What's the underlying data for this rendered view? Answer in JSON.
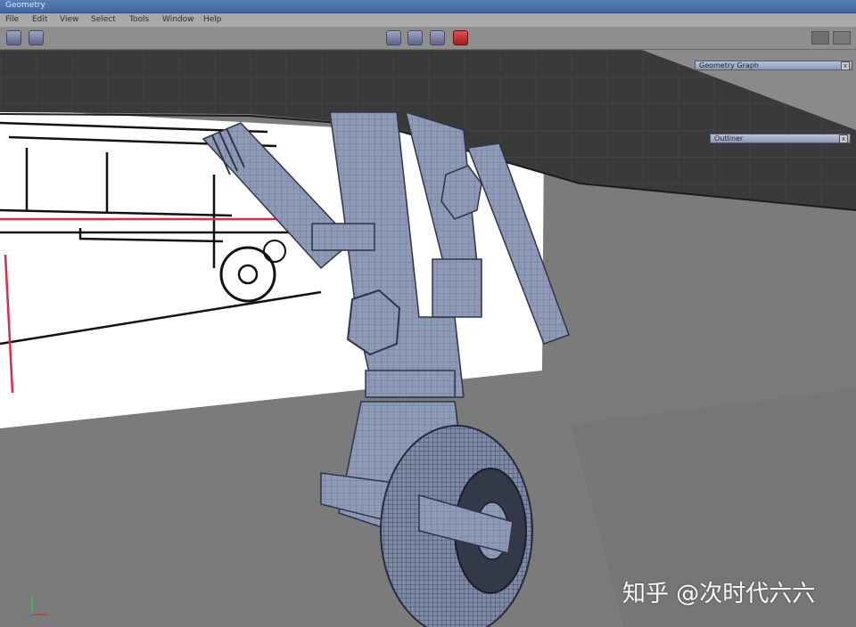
{
  "window": {
    "title": "Geometry"
  },
  "menu": {
    "items": [
      "File",
      "Edit",
      "View",
      "Select",
      "Tools",
      "Window",
      "Help"
    ]
  },
  "toolbar": {
    "left_buttons": [
      "cube-icon",
      "cube-icon"
    ],
    "center_buttons": [
      "shaded-cube-icon",
      "wireframe-cube-icon",
      "smooth-cube-icon",
      "red-cube-icon"
    ]
  },
  "panels": {
    "geometry_graph": "Geometry Graph",
    "outliner": "Outliner",
    "close_label": "x"
  },
  "watermark": {
    "text": "知乎 @次时代六六"
  },
  "colors": {
    "titlebar": "#4a71a8",
    "viewport": "#7d7d7d",
    "mesh": "#8c98b4",
    "active_tool": "#c22222"
  }
}
